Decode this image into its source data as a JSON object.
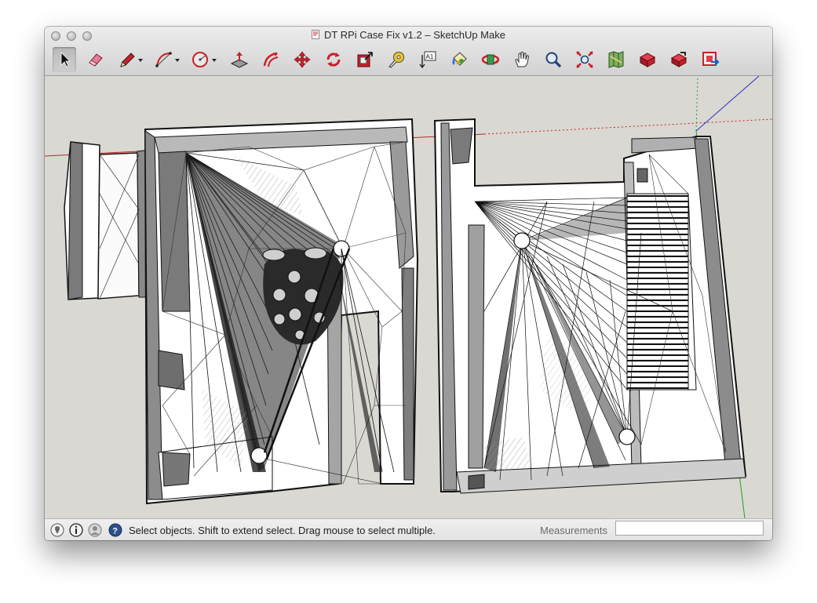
{
  "window": {
    "title": "DT RPi Case Fix v1.2 – SketchUp Make"
  },
  "toolbar": {
    "tools": [
      {
        "name": "select-tool",
        "icon": "arrow-cursor-icon",
        "active": true
      },
      {
        "name": "eraser-tool",
        "icon": "eraser-icon"
      },
      {
        "name": "pencil-tool",
        "icon": "pencil-icon",
        "has_menu": true
      },
      {
        "name": "arc-tool",
        "icon": "arc-icon",
        "has_menu": true
      },
      {
        "name": "shapes-tool",
        "icon": "circle-icon",
        "has_menu": true
      },
      {
        "name": "push-pull-tool",
        "icon": "push-pull-icon"
      },
      {
        "name": "offset-tool",
        "icon": "offset-icon"
      },
      {
        "name": "move-tool",
        "icon": "move-arrows-icon"
      },
      {
        "name": "rotate-tool",
        "icon": "rotate-icon"
      },
      {
        "name": "scale-tool",
        "icon": "scale-icon"
      },
      {
        "name": "tape-measure-tool",
        "icon": "tape-measure-icon"
      },
      {
        "name": "text-tool",
        "icon": "text-label-icon",
        "label": "A1"
      },
      {
        "name": "paint-bucket-tool",
        "icon": "paint-bucket-icon"
      },
      {
        "name": "orbit-tool",
        "icon": "orbit-icon"
      },
      {
        "name": "pan-tool",
        "icon": "hand-icon"
      },
      {
        "name": "zoom-tool",
        "icon": "magnifier-icon"
      },
      {
        "name": "zoom-extents-tool",
        "icon": "zoom-extents-icon"
      },
      {
        "name": "add-location-tool",
        "icon": "map-icon"
      },
      {
        "name": "3d-warehouse-tool",
        "icon": "warehouse-icon"
      },
      {
        "name": "share-model-tool",
        "icon": "share-model-icon"
      },
      {
        "name": "extension-warehouse-tool",
        "icon": "extension-warehouse-icon"
      }
    ]
  },
  "status": {
    "text": "Select objects. Shift to extend select. Drag mouse to select multiple.",
    "measurements_label": "Measurements",
    "measurements_value": "",
    "icons": [
      "geo-location-icon",
      "credits-icon",
      "user-account-icon",
      "help-icon"
    ]
  },
  "colors": {
    "viewport_bg": "#d9d8d3",
    "axis_red": "#cc2020",
    "axis_green": "#20a020",
    "axis_blue": "#2030c8",
    "tool_red": "#c8202a"
  }
}
